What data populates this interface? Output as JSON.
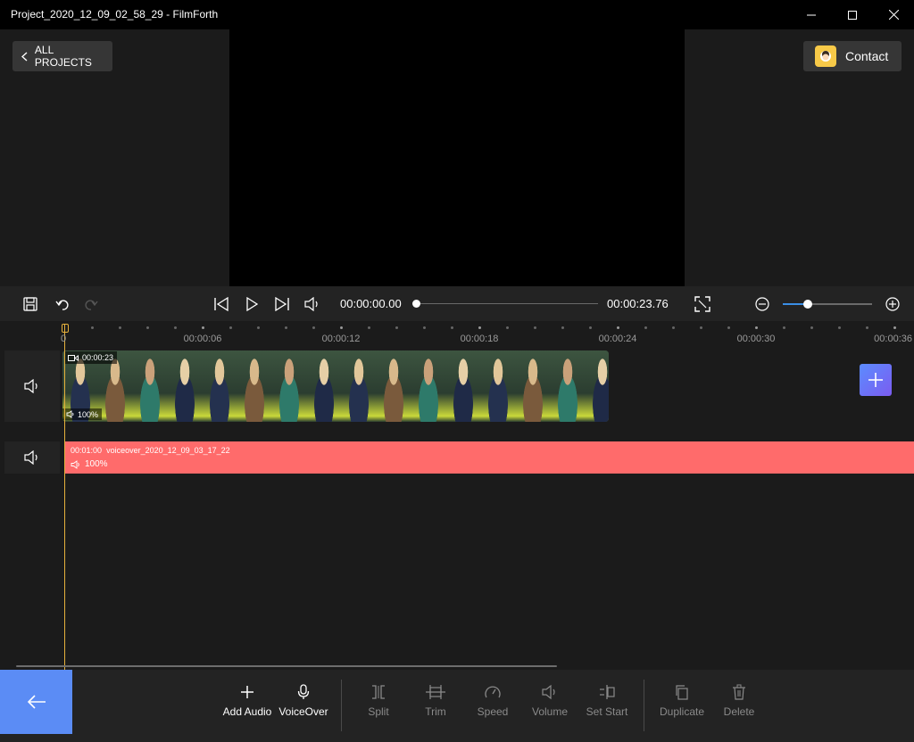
{
  "window": {
    "title": "Project_2020_12_09_02_58_29 - FilmForth"
  },
  "header": {
    "all_projects_label": "ALL PROJECTS",
    "contact_label": "Contact"
  },
  "controls": {
    "current_time": "00:00:00.00",
    "total_time": "00:00:23.76",
    "seek_progress": 0,
    "zoom_level": 0.28
  },
  "timeline": {
    "ruler": [
      "0",
      "00:00:06",
      "00:00:12",
      "00:00:18",
      "00:00:24",
      "00:00:30",
      "00:00:36"
    ],
    "video_track": {
      "clip_duration": "00:00:23",
      "clip_volume": "100%"
    },
    "voice_track": {
      "clip_start": "00:01:00",
      "clip_name": "voiceover_2020_12_09_03_17_22",
      "clip_volume": "100%",
      "color": "#ff6b6b"
    }
  },
  "toolbar": {
    "add_audio": "Add Audio",
    "voiceover": "VoiceOver",
    "split": "Split",
    "trim": "Trim",
    "speed": "Speed",
    "volume": "Volume",
    "set_start": "Set Start",
    "duplicate": "Duplicate",
    "delete": "Delete"
  },
  "colors": {
    "accent_blue": "#5b8cf5",
    "playhead": "#e7b23c",
    "voice_clip": "#ff6b6b"
  }
}
